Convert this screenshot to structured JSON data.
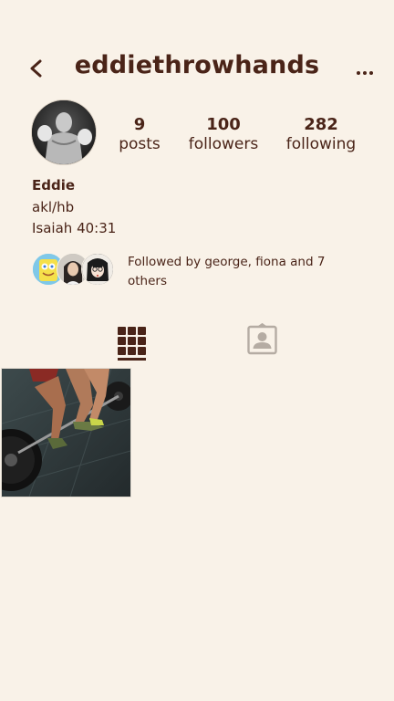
{
  "header": {
    "username": "eddiethrowhands",
    "back_icon": "chevron-left-icon",
    "more_icon": "ellipsis-icon"
  },
  "stats": {
    "posts": {
      "count": "9",
      "label": "posts"
    },
    "followers": {
      "count": "100",
      "label": "followers"
    },
    "following": {
      "count": "282",
      "label": "following"
    }
  },
  "bio": {
    "name": "Eddie",
    "line1": "akl/hb",
    "line2": "Isaiah 40:31"
  },
  "followed_by": {
    "text": "Followed by george, fiona and 7 others"
  },
  "tabs": {
    "grid_icon": "grid-icon",
    "tagged_icon": "tagged-person-icon",
    "active": "grid"
  },
  "posts": [
    {
      "image": "deadlift-photo"
    }
  ],
  "colors": {
    "background": "#f9f2e8",
    "text": "#4a2418",
    "inactive_icon": "#b5aca3"
  }
}
